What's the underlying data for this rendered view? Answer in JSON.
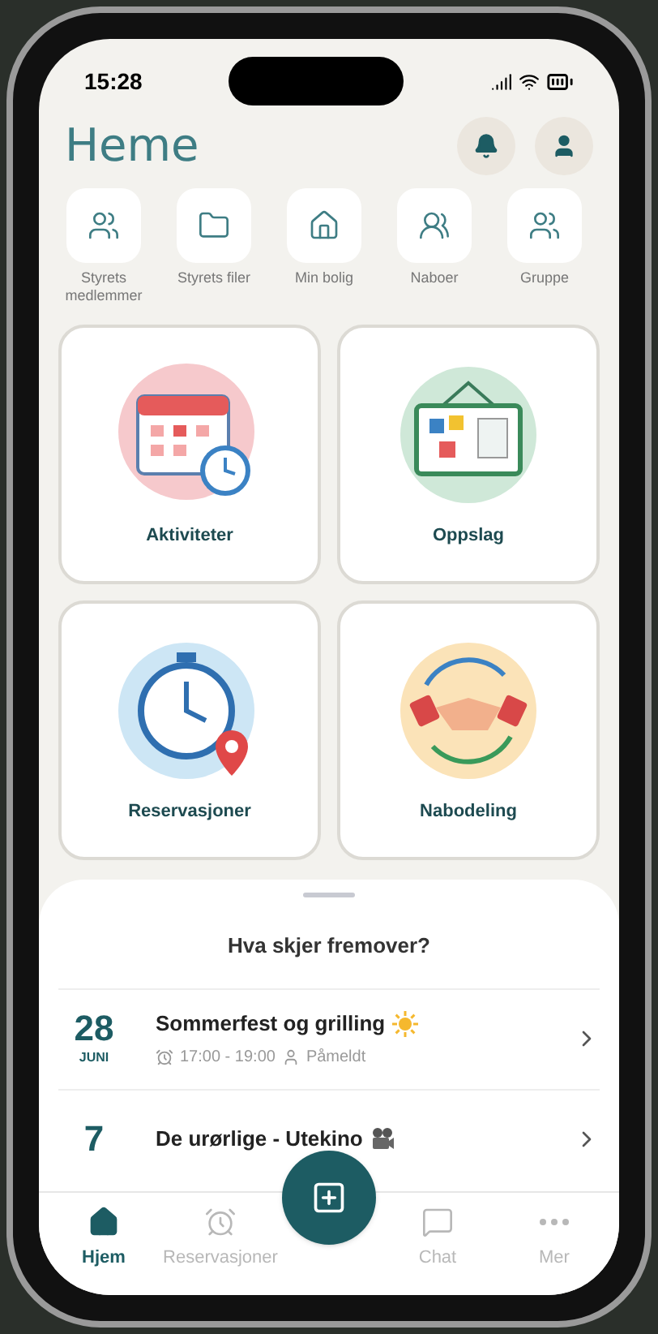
{
  "status_bar": {
    "time": "15:28"
  },
  "header": {
    "logo": "Heme"
  },
  "shortcuts": [
    {
      "label": "Styrets medlemmer",
      "kind": "board"
    },
    {
      "label": "Styrets filer",
      "kind": "folder"
    },
    {
      "label": "Min bolig",
      "kind": "home"
    },
    {
      "label": "Naboer",
      "kind": "neighbours"
    },
    {
      "label": "Gruppe",
      "kind": "groups"
    }
  ],
  "cards": [
    {
      "label": "Aktiviteter",
      "kind": "calendar"
    },
    {
      "label": "Oppslag",
      "kind": "board"
    },
    {
      "label": "Reservasjoner",
      "kind": "stopwatch"
    },
    {
      "label": "Nabodeling",
      "kind": "handshake"
    }
  ],
  "upcoming": {
    "title": "Hva skjer fremover?",
    "events": [
      {
        "day": "28",
        "month": "JUNI",
        "title": "Sommerfest og grilling",
        "kind": "sun",
        "time": "17:00 - 19:00",
        "status": "Påmeldt"
      },
      {
        "day": "7",
        "title": "De urørlige - Utekino",
        "kind": "camera"
      }
    ]
  },
  "nav": [
    {
      "label": "Hjem",
      "kind": "home",
      "selected": true
    },
    {
      "label": "Reservasjoner",
      "kind": "alarm",
      "selected": false
    },
    {
      "label": "Chat",
      "kind": "chat",
      "selected": false
    },
    {
      "label": "Mer",
      "kind": "more",
      "selected": false
    }
  ]
}
